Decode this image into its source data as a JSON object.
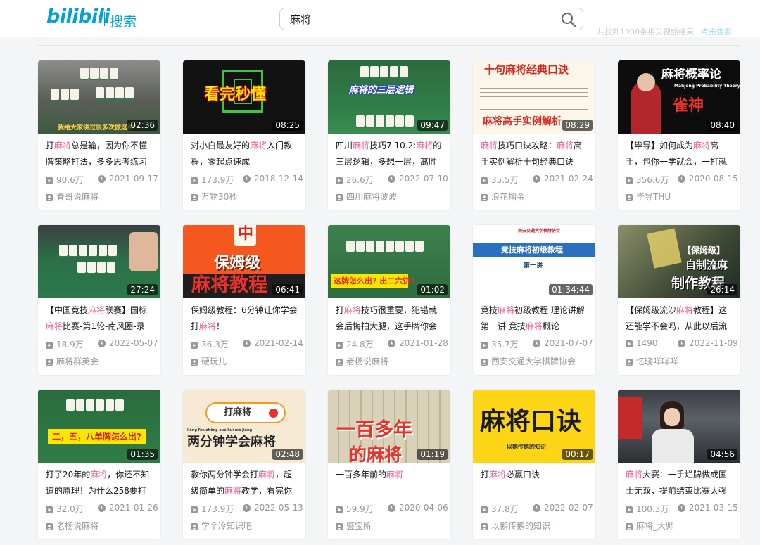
{
  "header": {
    "logo_text": "bilibili",
    "logo_sub": "搜索",
    "search_value": "麻将",
    "top_right_text": "共找到1000条相关视频结果",
    "top_right_link": "点击查看"
  },
  "colors": {
    "brand": "#00a1d6",
    "highlight": "#f25d8e",
    "meta": "#9499a0"
  },
  "icons": {
    "search": "search-icon",
    "play_count": "play-count-icon",
    "date": "clock-icon",
    "uploader": "uploader-icon"
  },
  "videos": [
    {
      "thumb_text": "我给大家讲过很多次做这种",
      "duration": "02:36",
      "title_parts": [
        "打",
        "麻将",
        "总是输，因为你不懂牌策略打法，多多思考练习"
      ],
      "views": "90.6万",
      "date": "2021-09-17",
      "uploader": "春哥说麻将"
    },
    {
      "thumb_text": "看完秒懂",
      "duration": "08:25",
      "title_parts": [
        "对小白最友好的",
        "麻将",
        "入门教程，零起点速成"
      ],
      "views": "173.9万",
      "date": "2018-12-14",
      "uploader": "万物30秒"
    },
    {
      "thumb_text": "麻将的三层逻辑",
      "duration": "09:47",
      "title_parts": [
        "四川",
        "麻将",
        "技巧7.10.2:",
        "麻将",
        "的三层逻辑，多想一层，离胜"
      ],
      "views": "26.6万",
      "date": "2022-07-10",
      "uploader": "四川麻将波波"
    },
    {
      "thumb_text": "十句麻将经典口诀",
      "thumb_text2": "麻将高手实例解析",
      "duration": "08:29",
      "title_parts": [
        "",
        "麻将",
        "技巧口诀攻略：",
        "麻将",
        "高手实例解析十句经典口诀"
      ],
      "views": "35.5万",
      "date": "2021-02-24",
      "uploader": "浪花掏金"
    },
    {
      "thumb_text": "麻将概率论",
      "thumb_text2": "Mahjong Probability Theory",
      "thumb_text3": "雀神",
      "duration": "08:40",
      "title_parts": [
        "【毕导】如何成为",
        "麻将",
        "高手，包你一学就会，一打就"
      ],
      "views": "356.6万",
      "date": "2020-08-15",
      "uploader": "毕导THU"
    },
    {
      "thumb_text": "",
      "duration": "27:24",
      "title_parts": [
        "【中国竞技",
        "麻将",
        "联赛】国标",
        "麻将",
        "比赛-第1轮-南风圈-录"
      ],
      "views": "18.9万",
      "date": "2022-05-07",
      "uploader": "麻将群英会"
    },
    {
      "thumb_text": "保姆级",
      "thumb_text2": "麻将教程",
      "thumb_text3": "中",
      "duration": "06:41",
      "title_parts": [
        "保姆级教程：6分钟让你学会打",
        "麻将",
        "！"
      ],
      "views": "36.3万",
      "date": "2021-02-14",
      "uploader": "硬玩儿"
    },
    {
      "thumb_text": "这牌怎么出? 出二六饼?",
      "duration": "01:02",
      "title_parts": [
        "打",
        "麻将",
        "技巧很重要，犯错就会后悔拍大腿，这手牌你会"
      ],
      "views": "24.8万",
      "date": "2021-01-28",
      "uploader": "老杨说麻将"
    },
    {
      "thumb_text": "竞技麻将初级教程",
      "thumb_text2": "第一讲",
      "thumb_text3": "西安交通大学棋牌协会",
      "duration": "01:34:44",
      "title_parts": [
        "竞技",
        "麻将",
        "初级教程 理论讲解第一讲 竞技",
        "麻将",
        "概论"
      ],
      "views": "35.7万",
      "date": "2021-07-07",
      "uploader": "西安交通大学棋牌协会"
    },
    {
      "thumb_text": "【保姆级】",
      "thumb_text2": "自制流麻",
      "thumb_text3": "制作教程",
      "duration": "26:14",
      "title_parts": [
        "【保姆级流沙",
        "麻将",
        "教程】这还能学不会吗，从此以后流"
      ],
      "views": "1490",
      "date": "2022-11-09",
      "uploader": "忆晓咩咩咩"
    },
    {
      "thumb_text": "二，五，八单牌怎么出?",
      "duration": "01:35",
      "title_parts": [
        "打了20年的",
        "麻将",
        "，你还不知道的原理！为什么258要打"
      ],
      "views": "32.0万",
      "date": "2021-01-26",
      "uploader": "老杨说麻将"
    },
    {
      "thumb_text": "打麻将",
      "thumb_text2": "两分钟学会麻将",
      "thumb_text3": "liǎng fēn zhōng xué huì má jiàng",
      "duration": "02:48",
      "title_parts": [
        "教你两分钟学会打",
        "麻将",
        "，超级简单的",
        "麻将",
        "教学，看完你"
      ],
      "views": "173.9万",
      "date": "2022-05-13",
      "uploader": "学个冷知识吧"
    },
    {
      "thumb_text": "一百多年",
      "thumb_text2": "的麻将",
      "duration": "01:19",
      "title_parts": [
        "一百多年前的",
        "麻将",
        ""
      ],
      "views": "59.9万",
      "date": "2020-04-06",
      "uploader": "鉴宝所"
    },
    {
      "thumb_text": "麻将口诀",
      "thumb_text2": "以鹅传鹅的知识",
      "duration": "00:17",
      "title_parts": [
        "打",
        "麻将",
        "必赢口诀"
      ],
      "views": "37.8万",
      "date": "2022-02-07",
      "uploader": "以鹅传鹅的知识"
    },
    {
      "thumb_text": "",
      "duration": "04:56",
      "title_parts": [
        "",
        "麻将",
        "大赛：一手烂牌做成国士无双，提前结束比赛太强"
      ],
      "views": "100.3万",
      "date": "2021-03-15",
      "uploader": "麻将_大师"
    }
  ]
}
